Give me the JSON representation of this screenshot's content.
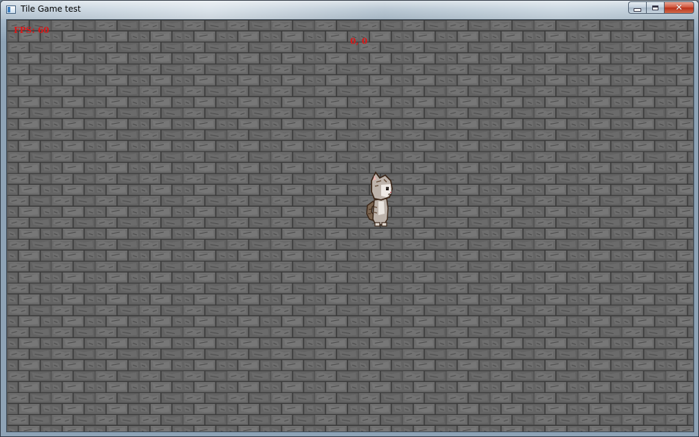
{
  "window": {
    "title": "Tile Game test",
    "icon": "app-window-icon",
    "controls": [
      "minimize-icon",
      "maximize-icon",
      "close-icon"
    ],
    "close_glyph": "✕"
  },
  "hud": {
    "fps": "FPS: 60",
    "coords": "0, 0"
  },
  "scene": {
    "background": "stone-brick-wall-tiles",
    "sprite": "cat-character",
    "colors": {
      "hud_text": "#d81818",
      "stone": "#5b5b5b"
    }
  }
}
